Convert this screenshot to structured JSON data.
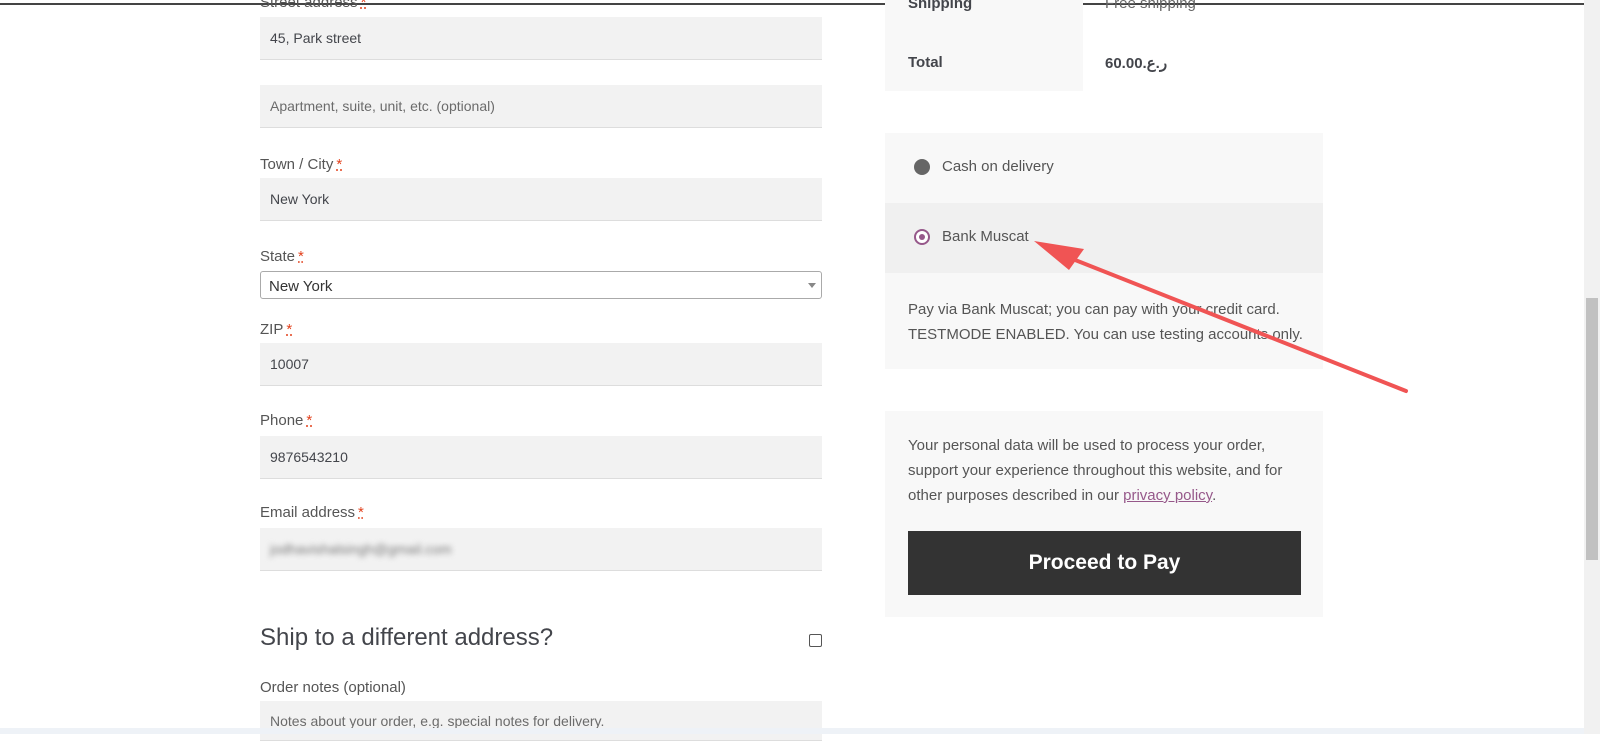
{
  "billing": {
    "street_label": "Street address",
    "street_value": "45, Park street",
    "apartment_placeholder": "Apartment, suite, unit, etc. (optional)",
    "city_label": "Town / City",
    "city_value": "New York",
    "state_label": "State",
    "state_value": "New York",
    "zip_label": "ZIP",
    "zip_value": "10007",
    "phone_label": "Phone",
    "phone_value": "9876543210",
    "email_label": "Email address",
    "email_value": "jodhavishalsingh@gmail.com",
    "required_marker": "*"
  },
  "shipping": {
    "ship_different_label": "Ship to a different address?",
    "order_notes_label": "Order notes (optional)",
    "order_notes_placeholder": "Notes about your order, e.g. special notes for delivery."
  },
  "order_summary": {
    "shipping_label": "Shipping",
    "shipping_value": "Free shipping",
    "total_label": "Total",
    "total_value": "60.00.ر.ع"
  },
  "payment": {
    "methods": [
      {
        "label": "Cash on delivery",
        "selected": false
      },
      {
        "label": "Bank Muscat",
        "selected": true
      }
    ],
    "description_line1": "Pay via Bank Muscat; you can pay with your credit card.",
    "description_line2": "TESTMODE ENABLED. You can use testing accounts only.",
    "privacy_text": "Your personal data will be used to process your order, support your experience throughout this website, and for other purposes described in our",
    "privacy_link": "privacy policy",
    "privacy_end": ".",
    "proceed_label": "Proceed to Pay"
  },
  "colors": {
    "accent": "#96588a",
    "button_bg": "#333333",
    "annotation_arrow": "#f05454",
    "required": "#e2401c"
  }
}
